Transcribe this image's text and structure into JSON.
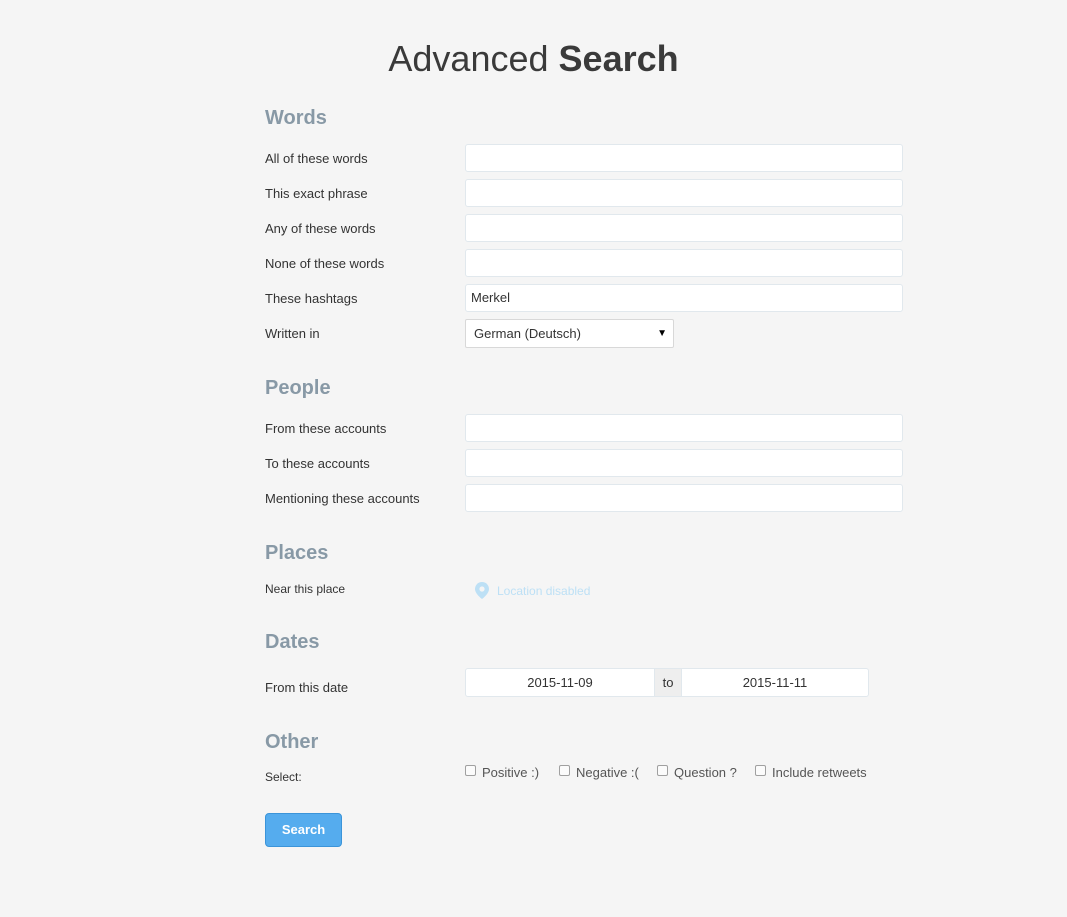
{
  "title": {
    "light": "Advanced",
    "bold": "Search"
  },
  "words": {
    "heading": "Words",
    "all_label": "All of these words",
    "all_value": "",
    "exact_label": "This exact phrase",
    "exact_value": "",
    "any_label": "Any of these words",
    "any_value": "",
    "none_label": "None of these words",
    "none_value": "",
    "hashtags_label": "These hashtags",
    "hashtags_value": "Merkel",
    "language_label": "Written in",
    "language_value": "German (Deutsch)"
  },
  "people": {
    "heading": "People",
    "from_label": "From these accounts",
    "from_value": "",
    "to_label": "To these accounts",
    "to_value": "",
    "mention_label": "Mentioning these accounts",
    "mention_value": ""
  },
  "places": {
    "heading": "Places",
    "near_label": "Near this place",
    "location_text": "Location disabled"
  },
  "dates": {
    "heading": "Dates",
    "from_label": "From this date",
    "from_value": "2015-11-09",
    "to_text": "to",
    "to_value": "2015-11-11"
  },
  "other": {
    "heading": "Other",
    "select_label": "Select:",
    "options": [
      "Positive :)",
      "Negative :(",
      "Question ?",
      "Include retweets"
    ]
  },
  "search_button": "Search",
  "colors": {
    "accent": "#55acee",
    "heading": "#8899a6",
    "location": "#bde0f5"
  },
  "icons": {
    "location": "map-pin-icon",
    "caret": "caret-down-icon"
  }
}
